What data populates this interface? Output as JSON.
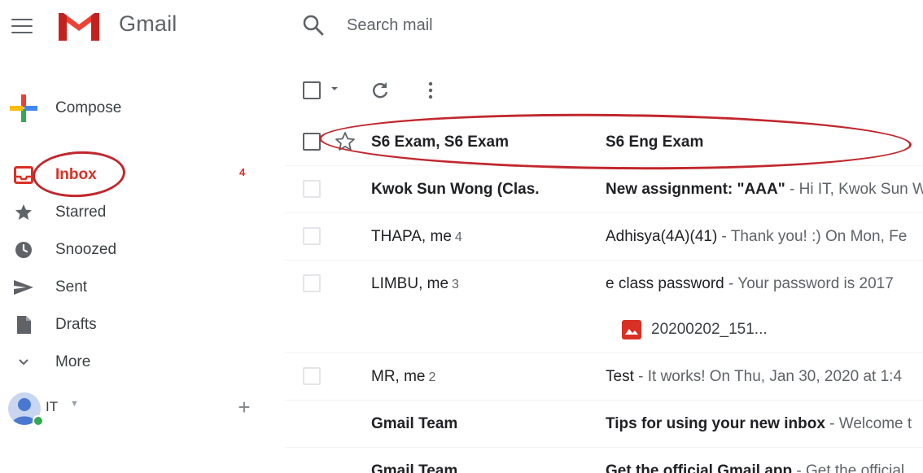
{
  "app": {
    "name": "Gmail"
  },
  "search": {
    "placeholder": "Search mail"
  },
  "compose": {
    "label": "Compose"
  },
  "sidebar": {
    "items": [
      {
        "label": "Inbox",
        "count": "4",
        "icon": "inbox-icon",
        "active": true
      },
      {
        "label": "Starred",
        "icon": "star-icon"
      },
      {
        "label": "Snoozed",
        "icon": "clock-icon"
      },
      {
        "label": "Sent",
        "icon": "send-icon"
      },
      {
        "label": "Drafts",
        "icon": "draft-icon"
      },
      {
        "label": "More",
        "icon": "chevron-down-icon"
      }
    ]
  },
  "account": {
    "name": "IT"
  },
  "emails": [
    {
      "sender": "S6 Exam, S6 Exam",
      "count": "",
      "subject": "S6 Eng Exam",
      "snippet": "",
      "unread": true
    },
    {
      "sender": "Kwok Sun Wong (Clas.",
      "count": "",
      "subject": "New assignment: \"AAA\"",
      "snippet": " - Hi IT, Kwok Sun W",
      "unread": true
    },
    {
      "sender": "THAPA, me",
      "count": "4",
      "subject": "Adhisya(4A)(41)",
      "snippet": " - Thank you! :) On Mon, Fe",
      "unread": false
    },
    {
      "sender": "LIMBU, me",
      "count": "3",
      "subject": "e class password",
      "snippet": " - Your password is 2017",
      "unread": false,
      "attachment": "20200202_151..."
    },
    {
      "sender": "MR, me",
      "count": "2",
      "subject": "Test",
      "snippet": " - It works! On Thu, Jan 30, 2020 at 1:4",
      "unread": false
    },
    {
      "sender": "Gmail Team",
      "count": "",
      "subject": "Tips for using your new inbox",
      "snippet": " - Welcome t",
      "unread": true
    },
    {
      "sender": "Gmail Team",
      "count": "",
      "subject": "Get the official Gmail app",
      "snippet": " - Get the official",
      "unread": true
    }
  ],
  "colors": {
    "accent": "#d93025",
    "annotation": "#c1272d",
    "presence": "#34a853"
  }
}
